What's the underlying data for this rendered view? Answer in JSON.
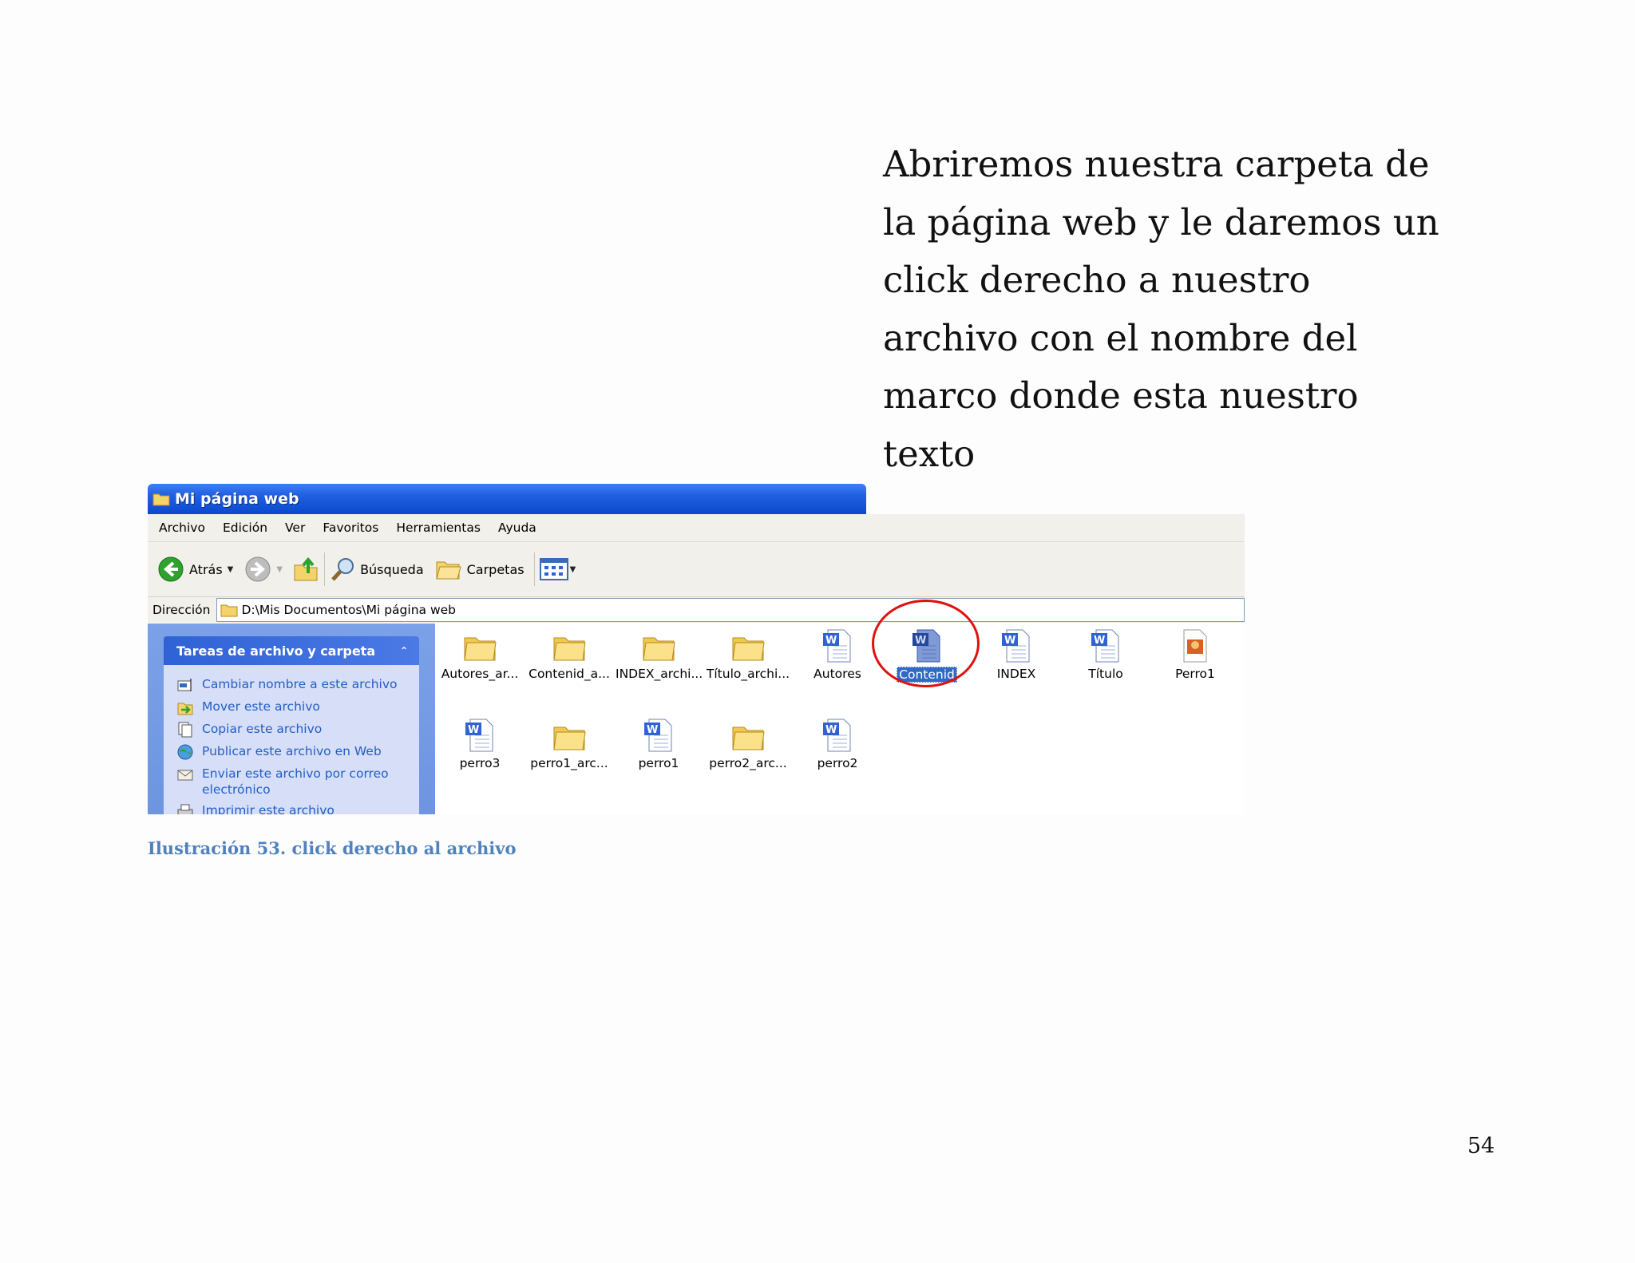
{
  "body_text": [
    "Abriremos nuestra carpeta de",
    "la página web y le daremos un",
    "click derecho a nuestro",
    "archivo con el nombre del",
    "marco donde esta nuestro",
    "texto"
  ],
  "window": {
    "title": "Mi página web",
    "menu": [
      "Archivo",
      "Edición",
      "Ver",
      "Favoritos",
      "Herramientas",
      "Ayuda"
    ],
    "toolbar": {
      "back": "Atrás",
      "search": "Búsqueda",
      "folders": "Carpetas"
    },
    "address": {
      "label": "Dirección",
      "path": "D:\\Mis Documentos\\Mi página web"
    },
    "tasks": {
      "title": "Tareas de archivo y carpeta",
      "items": [
        {
          "icon": "rename-icon",
          "label": "Cambiar nombre a este archivo"
        },
        {
          "icon": "move-icon",
          "label": "Mover este archivo"
        },
        {
          "icon": "copy-icon",
          "label": "Copiar este archivo"
        },
        {
          "icon": "publish-web-icon",
          "label": "Publicar este archivo en Web"
        },
        {
          "icon": "email-icon",
          "label": "Enviar este archivo por correo electrónico"
        },
        {
          "icon": "print-icon",
          "label": "Imprimir este archivo"
        }
      ]
    },
    "files": [
      {
        "label": "Autores_ar...",
        "type": "folder"
      },
      {
        "label": "Contenid_a...",
        "type": "folder"
      },
      {
        "label": "INDEX_archi...",
        "type": "folder"
      },
      {
        "label": "Título_archi...",
        "type": "folder"
      },
      {
        "label": "Autores",
        "type": "word"
      },
      {
        "label": "Contenid",
        "type": "word",
        "selected": true
      },
      {
        "label": "INDEX",
        "type": "word"
      },
      {
        "label": "Título",
        "type": "word"
      },
      {
        "label": "Perro1",
        "type": "image"
      },
      {
        "label": "perro3",
        "type": "word"
      },
      {
        "label": "perro1_arc...",
        "type": "folder"
      },
      {
        "label": "perro1",
        "type": "word"
      },
      {
        "label": "perro2_arc...",
        "type": "folder"
      },
      {
        "label": "perro2",
        "type": "word"
      }
    ]
  },
  "caption": "Ilustración 53. click derecho al archivo",
  "page_number": "54",
  "colors": {
    "caption": "#4f81bd",
    "highlight_circle": "#e01010",
    "selection": "#316ac5"
  }
}
